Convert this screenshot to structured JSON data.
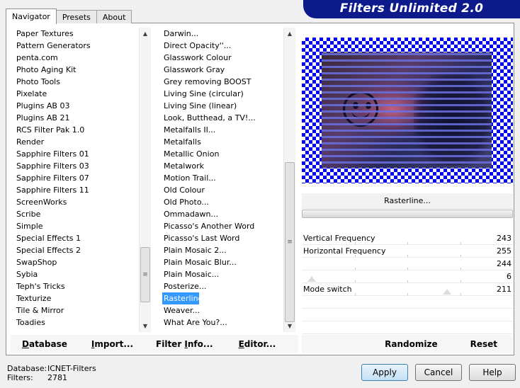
{
  "tabs": [
    {
      "label": "Navigator",
      "active": true
    },
    {
      "label": "Presets",
      "active": false
    },
    {
      "label": "About",
      "active": false
    }
  ],
  "banner": {
    "title": "Filters Unlimited 2.0"
  },
  "categories": [
    "Paper Textures",
    "Pattern Generators",
    "penta.com",
    "Photo Aging Kit",
    "Photo Tools",
    "Pixelate",
    "Plugins AB 03",
    "Plugins AB 21",
    "RCS Filter Pak 1.0",
    "Render",
    "Sapphire Filters 01",
    "Sapphire Filters 03",
    "Sapphire Filters 07",
    "Sapphire Filters 11",
    "ScreenWorks",
    "Scribe",
    "Simple",
    "Special Effects 1",
    "Special Effects 2",
    "SwapShop",
    "Sybia",
    "Teph's Tricks",
    "Texturize",
    "Tile & Mirror",
    "Toadies"
  ],
  "filters": [
    "Darwin...",
    "Direct Opacity''...",
    "Glasswork Colour",
    "Glasswork Gray",
    "Grey removing BOOST",
    "Living Sine (circular)",
    "Living Sine (linear)",
    "Look, Butthead, a TV!...",
    "Metalfalls II...",
    "Metalfalls",
    "Metallic Onion",
    "Metalwork",
    "Motion Trail...",
    "Old Colour",
    "Old Photo...",
    "Ommadawn...",
    "Picasso's Another Word",
    "Picasso's Last Word",
    "Plain Mosaic 2...",
    "Plain Mosaic Blur...",
    "Plain Mosaic...",
    "Posterize...",
    "Rasterline",
    "Weaver...",
    "What Are You?..."
  ],
  "selected_filter": "Rasterline",
  "filter_name": "Rasterline...",
  "controls": [
    {
      "label": "Vertical Frequency",
      "value": "243",
      "level": 243
    },
    {
      "label": "Horizontal Frequency",
      "value": "255",
      "level": 255
    },
    {
      "label": "",
      "value": "244",
      "level": 244
    },
    {
      "label": "",
      "value": "6",
      "level": 6
    },
    {
      "label": "Mode switch",
      "value": "211",
      "level": 211
    }
  ],
  "left_bar": {
    "database": {
      "underline": "D",
      "rest": "atabase"
    },
    "import": {
      "underline": "I",
      "rest": "mport..."
    },
    "filter_info": {
      "pre": "Filter ",
      "underline": "I",
      "rest": "nfo..."
    },
    "editor": {
      "underline": "E",
      "rest": "ditor..."
    }
  },
  "right_bar": {
    "randomize": "Randomize",
    "reset": "Reset"
  },
  "info": {
    "database_label": "Database:",
    "database_value": "ICNET-Filters",
    "filters_label": "Filters:",
    "filters_value": "2781"
  },
  "buttons": {
    "apply": "Apply",
    "cancel": "Cancel",
    "help": "Help"
  },
  "colors": {
    "checker": "#0000ff",
    "banner": "#0c1a8c",
    "selection": "#3399ff"
  }
}
